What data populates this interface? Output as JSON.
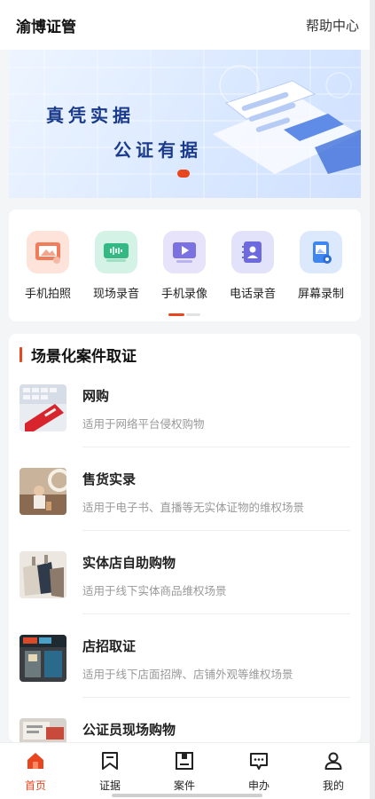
{
  "header": {
    "title": "渝博证管",
    "help": "帮助中心"
  },
  "banner": {
    "line1": "真凭实据",
    "line2": "公证有据"
  },
  "quick_actions": [
    {
      "label": "手机拍照",
      "icon": "photo-icon",
      "color": "#f2a38a"
    },
    {
      "label": "现场录音",
      "icon": "audio-recorder-icon",
      "color": "#4bc99a"
    },
    {
      "label": "手机录像",
      "icon": "video-icon",
      "color": "#8f86e8"
    },
    {
      "label": "电话录音",
      "icon": "contact-book-icon",
      "color": "#7e7ce6"
    },
    {
      "label": "屏幕录制",
      "icon": "screen-record-icon",
      "color": "#4f8ff0"
    }
  ],
  "cases": {
    "title": "场景化案件取证",
    "items": [
      {
        "name": "网购",
        "desc": "适用于网络平台侵权购物"
      },
      {
        "name": "售货实录",
        "desc": "适用于电子书、直播等无实体证物的维权场景"
      },
      {
        "name": "实体店自助购物",
        "desc": "适用于线下实体商品维权场景"
      },
      {
        "name": "店招取证",
        "desc": "适用于线下店面招牌、店铺外观等维权场景"
      },
      {
        "name": "公证员现场购物",
        "desc": ""
      }
    ]
  },
  "tabbar": [
    {
      "label": "首页",
      "icon": "home-icon",
      "active": true
    },
    {
      "label": "证据",
      "icon": "bookmark-icon",
      "active": false
    },
    {
      "label": "案件",
      "icon": "folder-icon",
      "active": false
    },
    {
      "label": "申办",
      "icon": "message-icon",
      "active": false
    },
    {
      "label": "我的",
      "icon": "user-icon",
      "active": false
    }
  ],
  "colors": {
    "accent": "#e8461f",
    "banner_text": "#1a3a8c"
  }
}
